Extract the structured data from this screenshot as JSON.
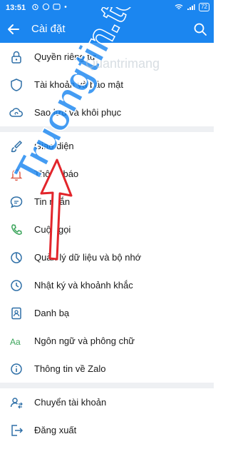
{
  "status": {
    "time": "13:51",
    "battery": "72"
  },
  "header": {
    "title": "Cài đặt"
  },
  "items": [
    {
      "label": "Quyền riêng tư",
      "icon": "lock-icon"
    },
    {
      "label": "Tài khoản và bảo mật",
      "icon": "shield-icon"
    },
    {
      "label": "Sao lưu và khôi phục",
      "icon": "cloud-sync-icon"
    },
    {
      "label": "Giao diện",
      "icon": "brush-icon"
    },
    {
      "label": "Thông báo",
      "icon": "bell-icon"
    },
    {
      "label": "Tin nhắn",
      "icon": "chat-icon"
    },
    {
      "label": "Cuộc gọi",
      "icon": "phone-icon"
    },
    {
      "label": "Quản lý dữ liệu và bộ nhớ",
      "icon": "pie-chart-icon"
    },
    {
      "label": "Nhật ký và khoảnh khắc",
      "icon": "clock-icon"
    },
    {
      "label": "Danh bạ",
      "icon": "contacts-icon"
    },
    {
      "label": "Ngôn ngữ và phông chữ",
      "icon": "font-icon"
    },
    {
      "label": "Thông tin về Zalo",
      "icon": "info-icon"
    },
    {
      "label": "Chuyển tài khoản",
      "icon": "switch-account-icon"
    },
    {
      "label": "Đăng xuất",
      "icon": "logout-icon"
    }
  ],
  "watermark": {
    "text": "Truongtin.top",
    "subtext": "Quantrimang"
  },
  "colors": {
    "accent": "#1b86f0",
    "icon": "#2e6fa7",
    "highlight_icon": "#e0604d",
    "arrow": "#e2252b"
  }
}
